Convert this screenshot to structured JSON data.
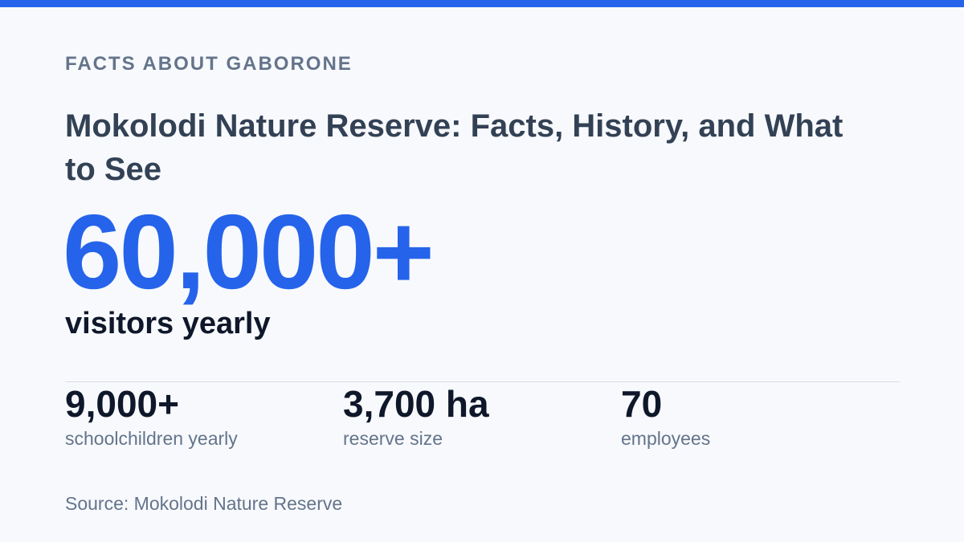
{
  "colors": {
    "accent": "#2563eb",
    "heading": "#334155",
    "text_dark": "#0f172a",
    "text_muted": "#64748b",
    "background": "#f7f9fc",
    "divider": "#d9dee6"
  },
  "header": {
    "kicker": "FACTS ABOUT GABORONE",
    "title": "Mokolodi Nature Reserve: Facts, History, and What to See"
  },
  "hero": {
    "value": "60,000+",
    "label": "visitors yearly"
  },
  "stats": [
    {
      "value": "9,000+",
      "label": "schoolchildren yearly"
    },
    {
      "value": "3,700 ha",
      "label": "reserve size"
    },
    {
      "value": "70",
      "label": "employees"
    }
  ],
  "footer": {
    "source": "Source: Mokolodi Nature Reserve"
  }
}
